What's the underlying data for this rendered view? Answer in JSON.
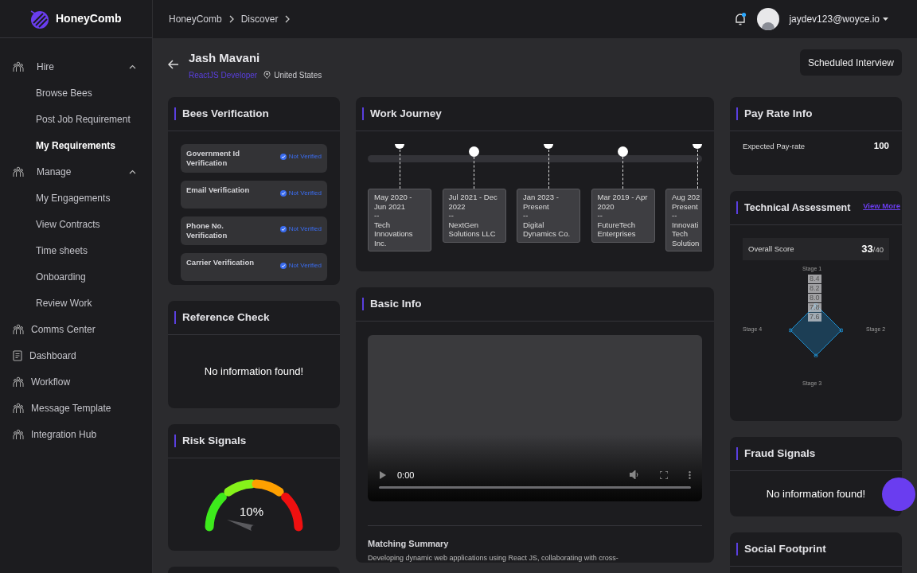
{
  "brand": "HoneyComb",
  "breadcrumb": [
    "HoneyComb",
    "Discover"
  ],
  "user": {
    "email": "jaydev123@woyce.io",
    "has_notification": true
  },
  "sidebar": {
    "items": [
      {
        "kind": "group",
        "label": "Hire",
        "expanded": true,
        "children": [
          {
            "label": "Browse Bees",
            "selected": false
          },
          {
            "label": "Post Job Requirement",
            "selected": false
          },
          {
            "label": "My Requirements",
            "selected": true
          }
        ]
      },
      {
        "kind": "group",
        "label": "Manage",
        "expanded": true,
        "children": [
          {
            "label": "My Engagements",
            "selected": false
          },
          {
            "label": "View Contracts",
            "selected": false
          },
          {
            "label": "Time sheets",
            "selected": false
          },
          {
            "label": "Onboarding",
            "selected": false
          },
          {
            "label": "Review Work",
            "selected": false
          }
        ]
      },
      {
        "kind": "link",
        "label": "Comms Center",
        "selected": false
      },
      {
        "kind": "doc",
        "label": "Dashboard",
        "selected": false
      },
      {
        "kind": "link",
        "label": "Workflow",
        "selected": false
      },
      {
        "kind": "link",
        "label": "Message Template",
        "selected": false
      },
      {
        "kind": "link",
        "label": "Integration Hub",
        "selected": false
      }
    ]
  },
  "profile": {
    "name": "Jash Mavani",
    "role": "ReactJS Developer",
    "location": "United States",
    "action": "Scheduled Interview"
  },
  "bees_verification": {
    "title": "Bees Verification",
    "items": [
      {
        "label": "Government Id Verification",
        "status": "Not Verified"
      },
      {
        "label": "Email Verification",
        "status": "Not Verified"
      },
      {
        "label": "Phone No. Verification",
        "status": "Not Verified"
      },
      {
        "label": "Carrier Verification",
        "status": "Not Verified"
      }
    ]
  },
  "reference_check": {
    "title": "Reference Check",
    "message": "No information found!"
  },
  "risk_signals": {
    "title": "Risk Signals",
    "reading": "10%"
  },
  "work_journey": {
    "title": "Work Journey",
    "items": [
      {
        "kind": "pin",
        "period": "May 2020 - Jun 2021",
        "separator": "--",
        "company": "Tech Innovations Inc."
      },
      {
        "kind": "dot",
        "period": "Jul 2021 - Dec 2022",
        "separator": "--",
        "company": "NextGen Solutions LLC"
      },
      {
        "kind": "pin",
        "period": "Jan 2023 - Present",
        "separator": "--",
        "company": "Digital Dynamics Co."
      },
      {
        "kind": "dot",
        "period": "Mar 2019 - Apr 2020",
        "separator": "--",
        "company": "FutureTech Enterprises"
      },
      {
        "kind": "pin",
        "period": "Aug 202\nPresent",
        "separator": "--",
        "company": "Innovati\nTech\nSolution"
      }
    ]
  },
  "basic_info": {
    "title": "Basic Info",
    "video": {
      "time": "0:00"
    },
    "summary_title": "Matching Summary",
    "summary": "Developing dynamic web applications using React JS, collaborating with cross-"
  },
  "pay_rate": {
    "title": "Pay Rate Info",
    "label": "Expected Pay-rate",
    "value": "100"
  },
  "technical_assessment": {
    "title": "Technical Assessment",
    "link": "View More",
    "score_label": "Overall Score",
    "score": "33",
    "score_total": "/40",
    "radar": {
      "axes": [
        "Stage 1",
        "Stage 2",
        "Stage 3",
        "Stage 4"
      ],
      "ticks": [
        "8.4",
        "8.2",
        "8.0",
        "7.8",
        "7.6"
      ]
    }
  },
  "fraud_signals": {
    "title": "Fraud Signals",
    "message": "No information found!"
  },
  "social_footprint": {
    "title": "Social Footprint"
  }
}
